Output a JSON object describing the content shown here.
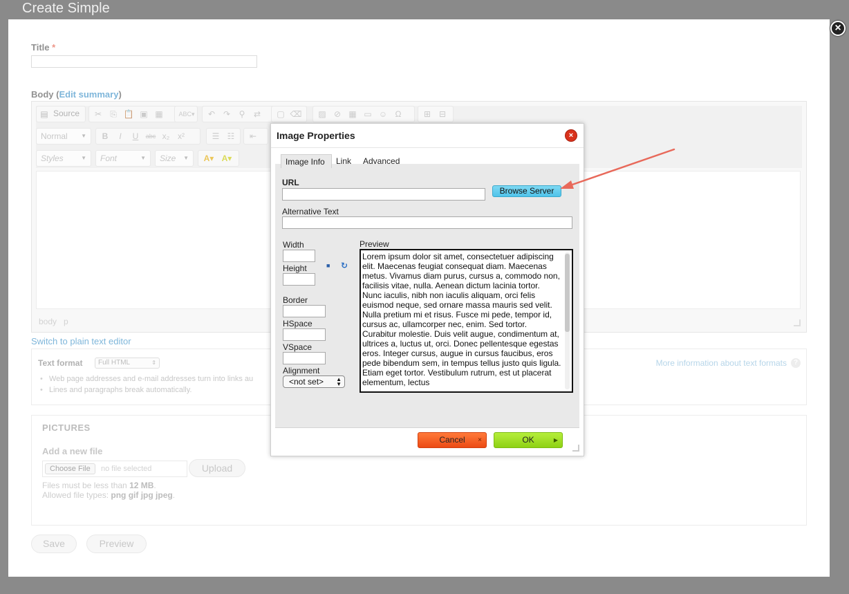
{
  "overlay": {
    "title": "Create Simple"
  },
  "form": {
    "title_label": "Title",
    "required_mark": "*",
    "body_label": "Body",
    "edit_summary": "Edit summary",
    "switch_link": "Switch to plain text editor",
    "text_format_label": "Text format",
    "text_format_value": "Full HTML",
    "more_info": "More information about text formats",
    "tips": [
      "Web page addresses and e-mail addresses turn into links au",
      "Lines and paragraphs break automatically."
    ],
    "pictures_title": "PICTURES",
    "add_new_file": "Add a new file",
    "choose_file": "Choose File",
    "no_file": "no file selected",
    "upload": "Upload",
    "size_note_prefix": "Files must be less than",
    "size_note_value": "12 MB",
    "types_note_prefix": "Allowed file types:",
    "types_note_value": "png gif jpg jpeg",
    "save": "Save",
    "preview": "Preview"
  },
  "editor": {
    "source_label": "Source",
    "format_select": "Normal",
    "styles_select": "Styles",
    "font_select": "Font",
    "size_select": "Size",
    "path_body": "body",
    "path_p": "p"
  },
  "dialog": {
    "title": "Image Properties",
    "tabs": [
      "Image Info",
      "Link",
      "Advanced"
    ],
    "url_label": "URL",
    "browse_server": "Browse Server",
    "alt_label": "Alternative Text",
    "width_label": "Width",
    "height_label": "Height",
    "border_label": "Border",
    "hspace_label": "HSpace",
    "vspace_label": "VSpace",
    "alignment_label": "Alignment",
    "alignment_value": "<not set>",
    "preview_label": "Preview",
    "preview_text": "Lorem ipsum dolor sit amet, consectetuer adipiscing elit. Maecenas feugiat consequat diam. Maecenas metus. Vivamus diam purus, cursus a, commodo non, facilisis vitae, nulla. Aenean dictum lacinia tortor. Nunc iaculis, nibh non iaculis aliquam, orci felis euismod neque, sed ornare massa mauris sed velit. Nulla pretium mi et risus. Fusce mi pede, tempor id, cursus ac, ullamcorper nec, enim. Sed tortor. Curabitur molestie. Duis velit augue, condimentum at, ultrices a, luctus ut, orci. Donec pellentesque egestas eros. Integer cursus, augue in cursus faucibus, eros pede bibendum sem, in tempus tellus justo quis ligula. Etiam eget tortor. Vestibulum rutrum, est ut placerat elementum, lectus",
    "cancel": "Cancel",
    "ok": "OK"
  },
  "colors": {
    "backdrop": "#8a8a8a",
    "link": "#3a8fc7",
    "browse": "#4fc3ea",
    "cancel": "#ec4a14",
    "ok": "#8ed114",
    "arrow": "#e8695a"
  }
}
